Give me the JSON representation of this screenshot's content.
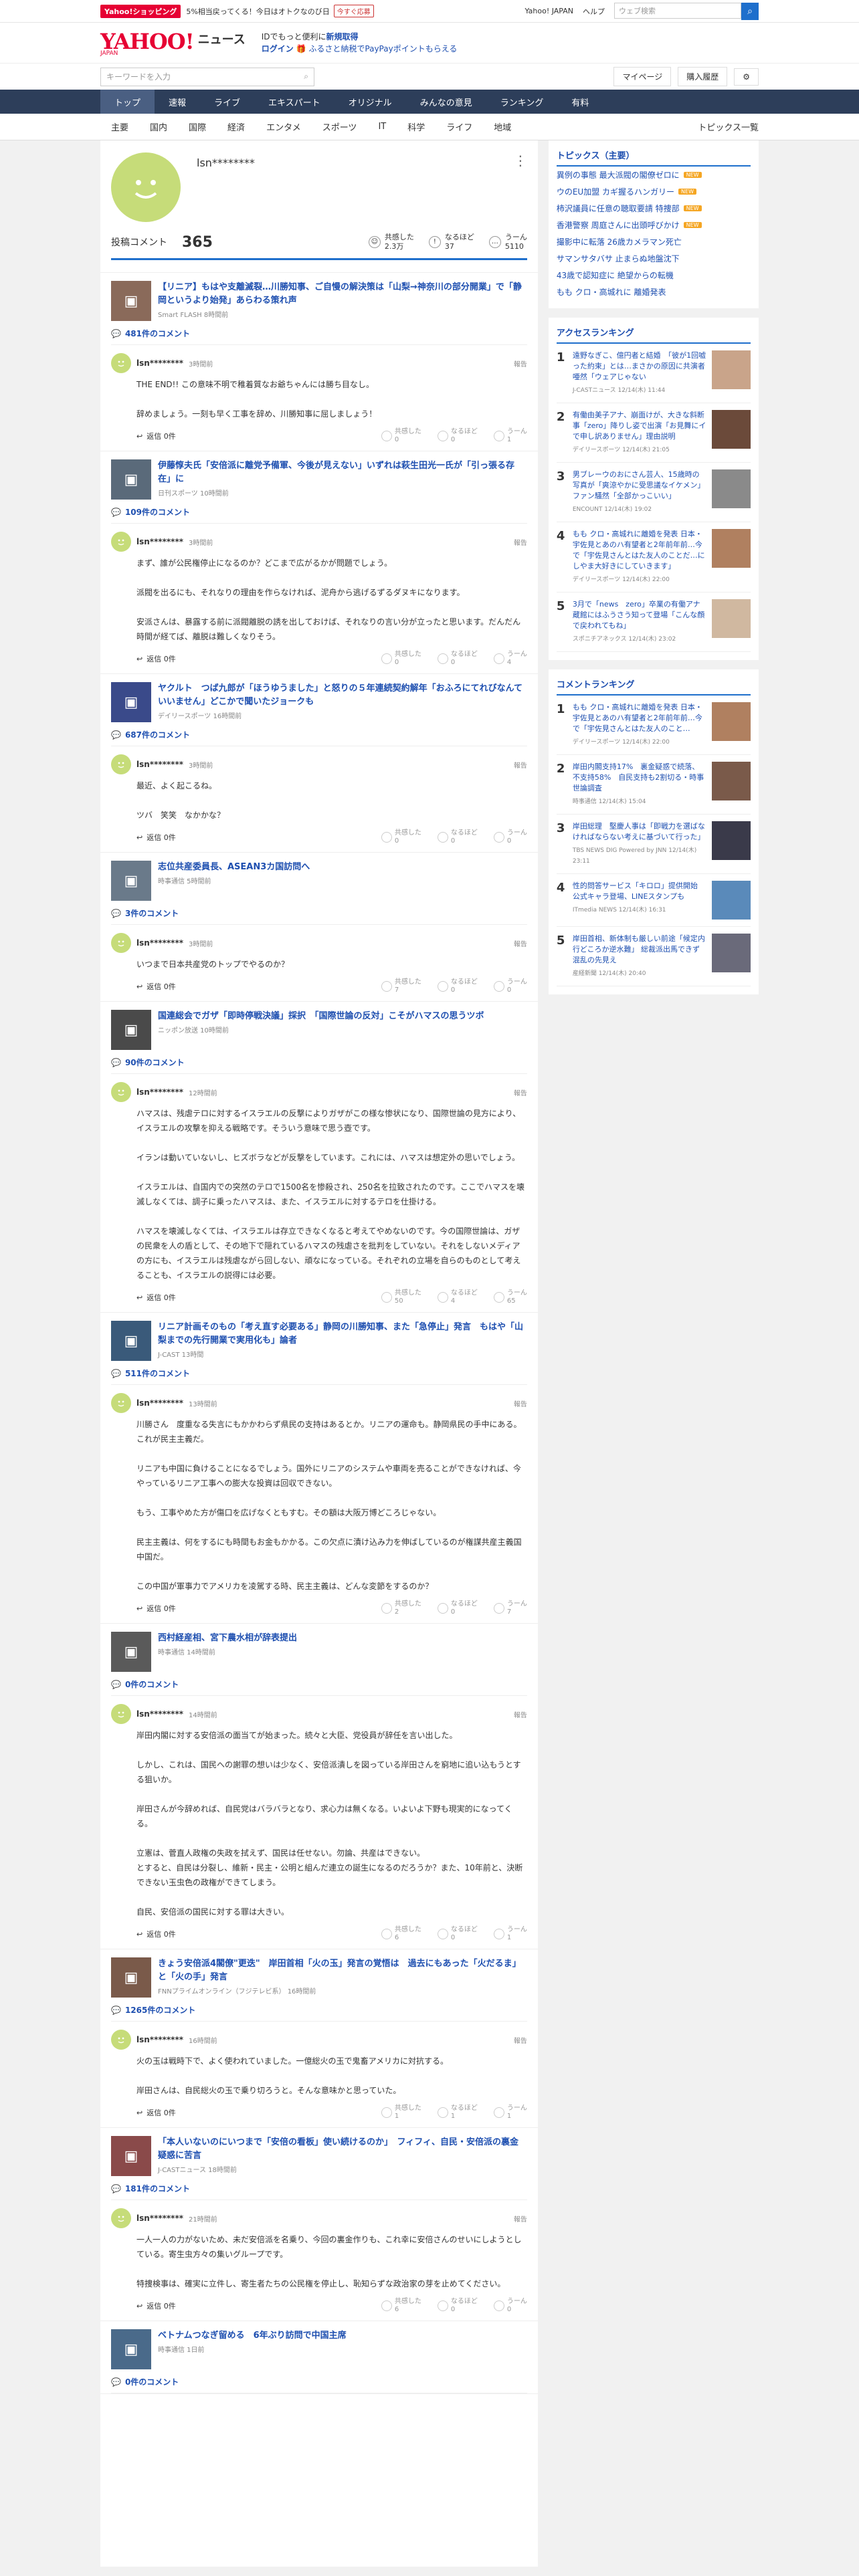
{
  "topbar": {
    "badge": "Yahoo!ショッピング",
    "promo": "5%相当戻ってくる！今日はオトクなのび日",
    "pill": "今すぐ応募",
    "links": [
      "Yahoo! JAPAN",
      "ヘルプ"
    ],
    "search_placeholder": "ウェブ検索"
  },
  "header": {
    "logo": "YAHOO!",
    "logo_sub": "JAPAN",
    "news": "ニュース",
    "msg1": "IDでもっと便利に",
    "msg1_link": "新規取得",
    "msg2_link": "ログイン",
    "msg2": "ふるさと納税でPayPayポイントもらえる"
  },
  "subnav": {
    "kw_placeholder": "キーワードを入力",
    "mypage": "マイページ",
    "history": "購入履歴"
  },
  "catnav": [
    "トップ",
    "速報",
    "ライブ",
    "エキスパート",
    "オリジナル",
    "みんなの意見",
    "ランキング",
    "有料"
  ],
  "subcat": [
    "主要",
    "国内",
    "国際",
    "経済",
    "エンタメ",
    "スポーツ",
    "IT",
    "科学",
    "ライフ",
    "地域"
  ],
  "subcat_more": "トピックス一覧",
  "profile": {
    "name": "lsn********",
    "label": "投稿コメント",
    "count": "365",
    "rx": [
      {
        "l": "共感した",
        "v": "2.3万"
      },
      {
        "l": "なるほど",
        "v": "37"
      },
      {
        "l": "うーん",
        "v": "5110"
      }
    ]
  },
  "articles": [
    {
      "title": "【リニア】もはや支離滅裂…川勝知事、ご自慢の解決策は「山梨→神奈川の部分開業」で「静岡というより始発」あらわる策れ声",
      "src": "Smart FLASH 8時間前",
      "count": "481件のコメント",
      "user": "lsn********",
      "time": "3時間前",
      "body": "THE END!! この意味不明で稚着質なお爺ちゃんには勝ち目なし。\n\n辞めましょう。一刻も早く工事を辞め、川勝知事に屈しましょう！",
      "votes": [
        "0",
        "0",
        "1"
      ]
    },
    {
      "title": "伊藤惇夫氏「安倍派に離党予備軍、今後が見えない」いずれは萩生田光一氏が「引っ張る存在」に",
      "src": "日刊スポーツ 10時間前",
      "count": "109件のコメント",
      "user": "lsn********",
      "time": "3時間前",
      "body": "まず、誰が公民権停止になるのか？どこまで広がるかが問題でしょう。\n\n派閥を出るにも、それなりの理由を作らなければ、泥舟から逃げるずるダヌキになります。\n\n安派さんは、暴露する前に派閥離脱の誘を出しておけば、それなりの言い分が立ったと思います。だんだん時間が経てば、離脱は難しくなりそう。",
      "votes": [
        "0",
        "0",
        "4"
      ]
    },
    {
      "title": "ヤクルト　つば九郎が「ほうゆうました」と怒りの５年連続契約解年「おふろにてれびなんていいません」どこかで聞いたジョークも",
      "src": "デイリースポーツ 16時間前",
      "count": "687件のコメント",
      "user": "lsn********",
      "time": "3時間前",
      "body": "最近、よく起こるね。\n\nツバ　笑笑　なかかな？",
      "votes": [
        "0",
        "0",
        "0"
      ]
    },
    {
      "title": "志位共産委員長、ASEAN3カ国訪問へ",
      "src": "時事通信 5時間前",
      "count": "3件のコメント",
      "user": "lsn********",
      "time": "3時間前",
      "body": "いつまで日本共産党のトップでやるのか？",
      "votes": [
        "7",
        "0",
        "0"
      ]
    },
    {
      "title": "国連総会でガザ「即時停戦決議」採択　「国際世論の反対」こそがハマスの思うツボ",
      "src": "ニッポン放送 10時間前",
      "count": "90件のコメント",
      "user": "lsn********",
      "time": "12時間前",
      "body": "ハマスは、残虐テロに対するイスラエルの反撃によりガザがこの様な惨状になり、国際世論の見方により、イスラエルの攻撃を抑える戦略です。そういう意味で思う壺です。\n\nイランは動いていないし、ヒズボラなどが反撃をしています。これには、ハマスは想定外の思いでしょう。\n\nイスラエルは、自国内での突然のテロで1500名を惨殺され、250名を拉致されたのです。ここでハマスを壊滅しなくては、調子に乗ったハマスは、また、イスラエルに対するテロを仕掛ける。\n\nハマスを壊滅しなくては、イスラエルは存立できなくなると考えてやめないのです。今の国際世論は、ガザの民衆を人の盾として、その地下で隠れているハマスの残虐さを批判をしていない。それをしないメディアの方にも、イスラエルは残虐ながら回しない、頑なになっている。それぞれの立場を自らのものとして考えることも、イスラエルの説得には必要。",
      "votes": [
        "50",
        "4",
        "65"
      ]
    },
    {
      "title": "リニア計画そのもの「考え直す必要ある」静岡の川勝知事、また「急停止」発言　もはや「山梨までの先行開業で実用化も」論者",
      "src": "J-CAST 13時間",
      "count": "511件のコメント",
      "user": "lsn********",
      "time": "13時間前",
      "body": "川勝さん　度重なる失言にもかかわらず県民の支持はあるとか。リニアの運命も。静岡県民の手中にある。これが民主主義だ。\n\nリニアも中国に負けることになるでしょう。国外にリニアのシステムや車両を売ることができなければ、今やっているリニア工事への膨大な投資は回収できない。\n\nもう、工事やめた方が傷口を広げなくともすむ。その額は大阪万博どころじゃない。\n\n民主主義は、何をするにも時間もお金もかかる。この欠点に漬け込み力を伸ばしているのが権謀共産主義国　中国だ。\n\nこの中国が軍事力でアメリカを凌駕する時、民主主義は、どんな変節をするのか？",
      "votes": [
        "2",
        "0",
        "7"
      ]
    },
    {
      "title": "西村経産相、宮下農水相が辞表提出",
      "src": "時事通信 14時間前",
      "count": "0件のコメント",
      "user": "lsn********",
      "time": "14時間前",
      "body": "岸田内閣に対する安倍派の面当てが始まった。続々と大臣、党役員が辞任を言い出した。\n\nしかし、これは、国民への謝罪の想いは少なく、安倍派潰しを図っている岸田さんを窮地に追い込もうとする狙いか。\n\n岸田さんが今辞めれば、自民党はバラバラとなり、求心力は無くなる。いよいよ下野も現実的になってくる。\n\n立憲は、菅直人政権の失政を拭えず、国民は任せない。勿論、共産はできない。\nとすると、自民は分裂し、維新・民主・公明と組んだ連立の誕生になるのだろうか？また、10年前と、決断できない玉虫色の政権ができてしまう。\n\n自民、安倍派の国民に対する罪は大きい。",
      "votes": [
        "6",
        "0",
        "1"
      ]
    },
    {
      "title": "きょう安倍派4閣僚\"更迭\"　岸田首相「火の玉」発言の覚悟は　過去にもあった「火だるま」と「火の手」発言",
      "src": "FNNプライムオンライン（フジテレビ系） 16時間前",
      "count": "1265件のコメント",
      "user": "lsn********",
      "time": "16時間前",
      "body": "火の玉は戦時下で、よく使われていました。一億総火の玉で鬼畜アメリカに対抗する。\n\n岸田さんは、自民総火の玉で乗り切ろうと。そんな意味かと思っていた。",
      "votes": [
        "1",
        "1",
        "1"
      ]
    },
    {
      "title": "「本人いないのにいつまで「安倍の看板」使い続けるのか」　フィフィ、自民・安倍派の裏金疑惑に苦言",
      "src": "J-CASTニュース 18時間前",
      "count": "181件のコメント",
      "user": "lsn********",
      "time": "21時間前",
      "body": "一人一人の力がないため、未だ安倍派を名乗り、今回の裏金作りも、これ幸に安倍さんのせいにしようとしている。寄生虫方々の集いグループです。\n\n特捜検事は、確実に立件し、寄生者たちの公民権を停止し、恥知らずな政治家の芽を止めてください。",
      "votes": [
        "6",
        "0",
        "0"
      ]
    },
    {
      "title": "ベトナムつなぎ留める　6年ぶり訪問で中国主席",
      "src": "時事通信 1日前",
      "count": "0件のコメント",
      "user": "",
      "time": "",
      "body": "",
      "votes": [
        "",
        "",
        ""
      ]
    }
  ],
  "side": {
    "topics_title": "トピックス（主要）",
    "topics": [
      {
        "t": "異例の事態 最大派閥の閣僚ゼロに",
        "n": "NEW"
      },
      {
        "t": "ウのEU加盟 カギ握るハンガリー",
        "n": "NEW"
      },
      {
        "t": "柿沢議員に任意の聴取要請 特捜部",
        "n": "NEW"
      },
      {
        "t": "香港警察 周庭さんに出頭呼びかけ",
        "n": "NEW"
      },
      {
        "t": "撮影中に転落 26歳カメラマン死亡",
        "n": ""
      },
      {
        "t": "サマンサタバサ 止まらぬ地盤沈下",
        "n": ""
      },
      {
        "t": "43歳で認知症に 絶望からの転機",
        "n": ""
      },
      {
        "t": "もも クロ・高城れに 離婚発表",
        "n": ""
      }
    ],
    "access_title": "アクセスランキング",
    "access": [
      {
        "t": "遠野なぎこ、億円者と結婚　「彼が1回嘘った約束」とは…まさかの原因に共演者唖然「ウェアじゃない",
        "s": "J-CASTニュース 12/14(木) 11:44"
      },
      {
        "t": "有働由美子アナ、崩面けが、大きな斜断事「zero」降りし姿で出演「お見舞にイで申し訳ありません」理由説明",
        "s": "デイリースポーツ 12/14(木) 21:05"
      },
      {
        "t": "男ブレーウのおにさん芸人、15歳時の写真が「爽涼やかに受思議なイケメン」 ファン騒然「全部かっこいい」",
        "s": "ENCOUNT 12/14(木) 19:02"
      },
      {
        "t": "もも クロ・高城れに離婚を発表 日本・宇佐見とあのハ有望者と2年前年前…今で「宇佐見さんとはた友人のことだ…にしやま大好きにしていきます」",
        "s": "デイリースポーツ 12/14(木) 22:00"
      },
      {
        "t": "3月で「news　zero」卒業の有働アナ　蔵館にはふうさう知って登場「こんな顔で戻われてもね」",
        "s": "スポニチアネックス 12/14(木) 23:02"
      }
    ],
    "comment_title": "コメントランキング",
    "cranks": [
      {
        "t": "もも クロ・高城れに離婚を発表 日本・宇佐見とあのハ有望者と2年前年前…今で「宇佐見さんとはた友人のこと…",
        "s": "デイリースポーツ 12/14(木) 22:00"
      },
      {
        "t": "岸田内閣支持17%　裏金疑惑で続落、不支持58%　自民支持も2割切る・時事世論調査",
        "s": "時事通信 12/14(木) 15:04"
      },
      {
        "t": "岸田総理　堅慶人事は「即戦力を選ばなければならない考えに基づいて行った」",
        "s": "TBS NEWS DIG Powered by JNN 12/14(木) 23:11"
      },
      {
        "t": "性的問答サービス「キロロ」提供開始　公式キャラ登場、LINEスタンプも",
        "s": "ITmedia NEWS 12/14(木) 16:31"
      },
      {
        "t": "岸田首相、新体制も厳しい前途「候定内行どころか逆水難」 総裁派出馬できず混乱の先見え",
        "s": "産経新聞 12/14(木) 20:40"
      }
    ]
  },
  "report": "報告",
  "reply": "返信 0件",
  "vote_labels": [
    "共感した",
    "なるほど",
    "うーん"
  ]
}
